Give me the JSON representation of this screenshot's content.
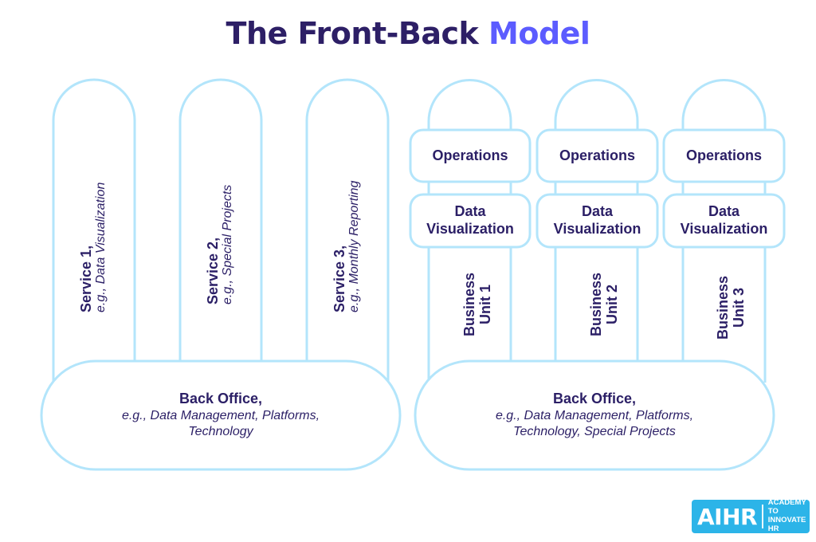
{
  "title": {
    "main": "The Front-Back Model",
    "prefix": "The Front-Back",
    "accent": "Model"
  },
  "colors": {
    "title": "#2d1f66",
    "accent": "#5c5cff",
    "outline": "#b3e5fb",
    "text": "#2b1f66",
    "logo_bg": "#2cb4e8"
  },
  "left_model": {
    "services": [
      {
        "name": "Service 1,",
        "example": "e.g., Data Visualization"
      },
      {
        "name": "Service 2,",
        "example": "e.g., Special Projects"
      },
      {
        "name": "Service 3,",
        "example": "e.g., Monthly Reporting"
      }
    ],
    "back_office": {
      "title": "Back Office,",
      "line1": "e.g., Data Management, Platforms,",
      "line2": "Technology"
    }
  },
  "right_model": {
    "units": [
      {
        "operations": "Operations",
        "dataviz_line1": "Data",
        "dataviz_line2": "Visualization",
        "unit_line1": "Business",
        "unit_line2": "Unit 1"
      },
      {
        "operations": "Operations",
        "dataviz_line1": "Data",
        "dataviz_line2": "Visualization",
        "unit_line1": "Business",
        "unit_line2": "Unit 2"
      },
      {
        "operations": "Operations",
        "dataviz_line1": "Data",
        "dataviz_line2": "Visualization",
        "unit_line1": "Business",
        "unit_line2": "Unit 3"
      }
    ],
    "back_office": {
      "title": "Back Office,",
      "line1": "e.g., Data Management, Platforms,",
      "line2": "Technology, Special Projects"
    }
  },
  "logo": {
    "mark": "AIHR",
    "tagline_line1": "ACADEMY TO",
    "tagline_line2": "INNOVATE HR"
  }
}
